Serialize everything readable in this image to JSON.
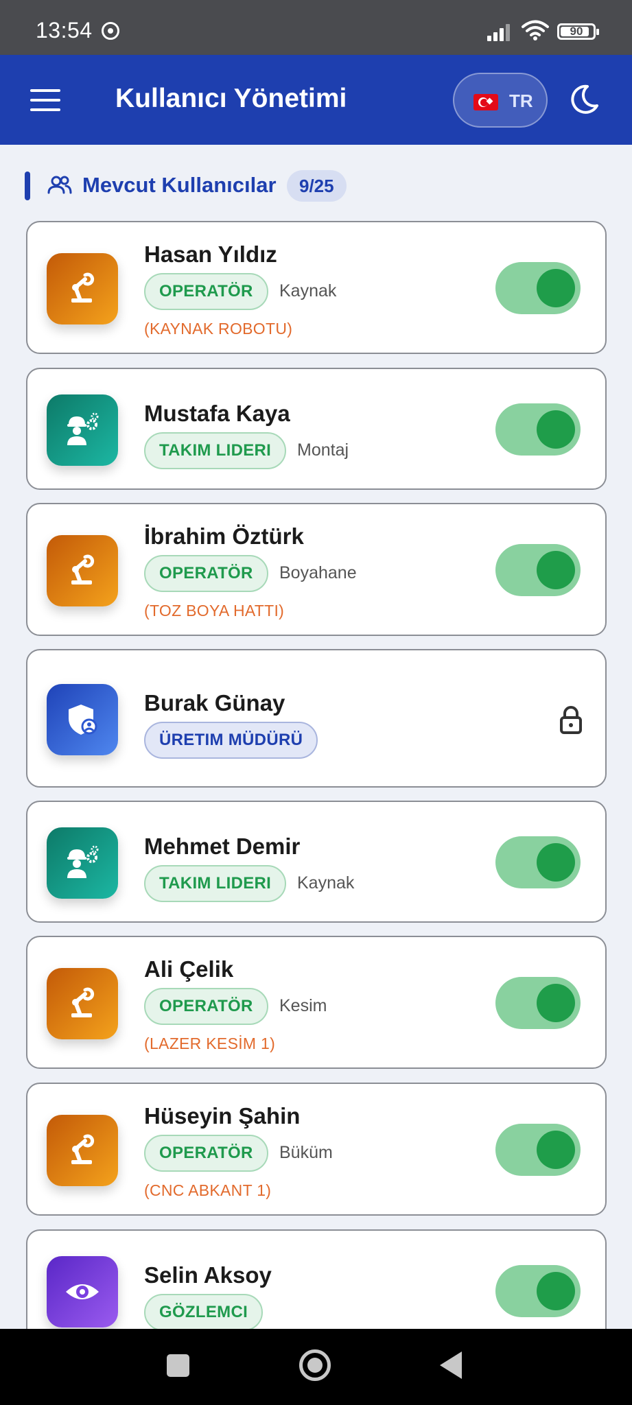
{
  "status_bar": {
    "time": "13:54",
    "battery": "90"
  },
  "header": {
    "title": "Kullanıcı Yönetimi",
    "language": "TR"
  },
  "section": {
    "title": "Mevcut Kullanıcılar",
    "count": "9/25"
  },
  "users": [
    {
      "name": "Hasan Yıldız",
      "role": "OPERATÖR",
      "department": "Kaynak",
      "machine": "(KAYNAK ROBOTU)",
      "toggle": "on"
    },
    {
      "name": "Mustafa Kaya",
      "role": "TAKIM LIDERI",
      "department": "Montaj",
      "toggle": "on"
    },
    {
      "name": "İbrahim Öztürk",
      "role": "OPERATÖR",
      "department": "Boyahane",
      "machine": "(TOZ BOYA HATTI)",
      "toggle": "on"
    },
    {
      "name": "Burak Günay",
      "role": "ÜRETIM MÜDÜRÜ",
      "locked": true
    },
    {
      "name": "Mehmet Demir",
      "role": "TAKIM LIDERI",
      "department": "Kaynak",
      "toggle": "on"
    },
    {
      "name": "Ali Çelik",
      "role": "OPERATÖR",
      "department": "Kesim",
      "machine": "(LAZER KESİM 1)",
      "toggle": "on"
    },
    {
      "name": "Hüseyin Şahin",
      "role": "OPERATÖR",
      "department": "Büküm",
      "machine": "(CNC ABKANT 1)",
      "toggle": "on"
    },
    {
      "name": "Selin Aksoy",
      "role": "GÖZLEMCI",
      "toggle": "on"
    }
  ],
  "icons": {
    "operator": "robot-arm-icon",
    "team_leader": "worker-gears-icon",
    "manager": "shield-user-icon",
    "observer": "eye-icon"
  },
  "colors": {
    "primary": "#1e3faf",
    "toggle_on": "#1f9d4a",
    "machine_text": "#e26a2c",
    "role_green": "#1f9a4d"
  }
}
